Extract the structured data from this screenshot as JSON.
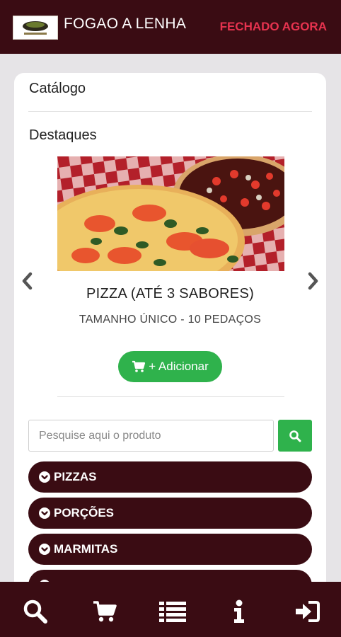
{
  "header": {
    "title": "FOGAO A LENHA",
    "status": "FECHADO AGORA",
    "logo_icon": "restaurant-logo"
  },
  "catalog": {
    "title": "Catálogo",
    "featured_title": "Destaques",
    "featured": {
      "product_name": "PIZZA (ATÉ 3 SABORES)",
      "product_size": "TAMANHO ÚNICO - 10 PEDAÇOS",
      "add_label": "+ Adicionar",
      "image_icon": "pizza-photo"
    },
    "search": {
      "placeholder": "Pesquise aqui o produto",
      "value": ""
    },
    "categories": [
      {
        "label": "PIZZAS"
      },
      {
        "label": "PORÇÕES"
      },
      {
        "label": "MARMITAS"
      },
      {
        "label": ""
      }
    ]
  },
  "bottom_nav": [
    {
      "icon": "search-icon"
    },
    {
      "icon": "cart-icon"
    },
    {
      "icon": "list-icon"
    },
    {
      "icon": "info-icon"
    },
    {
      "icon": "login-icon"
    }
  ],
  "colors": {
    "primary": "#3a0c13",
    "accent_green": "#2fb24c",
    "status_red": "#e8334f",
    "background": "#e6e4e7"
  }
}
